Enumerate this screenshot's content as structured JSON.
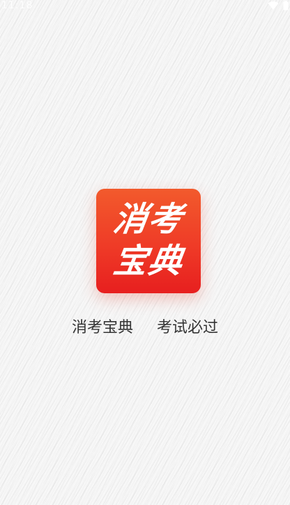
{
  "status_bar": {
    "time": "11:18",
    "icons": [
      "wifi-icon",
      "battery-icon"
    ]
  },
  "logo": {
    "line1": "消考",
    "line2": "宝典",
    "gradient_top": "#f25a2c",
    "gradient_bottom": "#e71f1f"
  },
  "tagline": {
    "app_name": "消考宝典",
    "slogan": "考试必过"
  },
  "colors": {
    "background": "#f4f4f4",
    "tagline_text": "#333333",
    "logo_text": "#ffffff"
  }
}
